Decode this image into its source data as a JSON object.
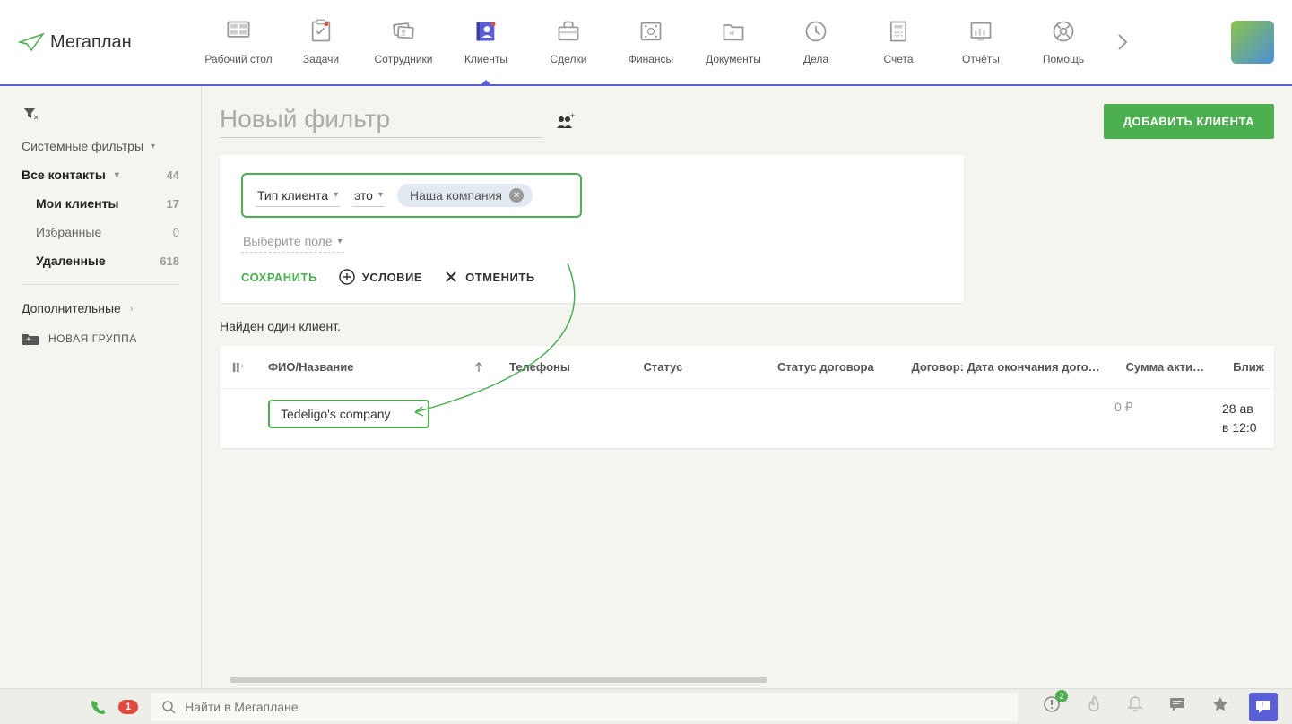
{
  "logo": "Мегаплан",
  "nav": [
    {
      "label": "Рабочий стол"
    },
    {
      "label": "Задачи"
    },
    {
      "label": "Сотрудники"
    },
    {
      "label": "Клиенты",
      "active": true
    },
    {
      "label": "Сделки"
    },
    {
      "label": "Финансы"
    },
    {
      "label": "Документы"
    },
    {
      "label": "Дела"
    },
    {
      "label": "Счета"
    },
    {
      "label": "Отчёты"
    },
    {
      "label": "Помощь"
    }
  ],
  "sidebar": {
    "system_filters": "Системные фильтры",
    "all_contacts": {
      "label": "Все контакты",
      "count": "44"
    },
    "my_clients": {
      "label": "Мои клиенты",
      "count": "17"
    },
    "favorites": {
      "label": "Избранные",
      "count": "0"
    },
    "deleted": {
      "label": "Удаленные",
      "count": "618"
    },
    "additional": "Дополнительные",
    "new_group": "НОВАЯ ГРУППА"
  },
  "page": {
    "title": "Новый фильтр",
    "add_button": "ДОБАВИТЬ КЛИЕНТА"
  },
  "filter": {
    "field": "Тип клиента",
    "op": "это",
    "value": "Наша компания",
    "select_label": "Выберите поле",
    "save": "СОХРАНИТЬ",
    "condition": "УСЛОВИЕ",
    "cancel": "ОТМЕНИТЬ"
  },
  "results_text": "Найден один клиент.",
  "table": {
    "cols": {
      "name": "ФИО/Название",
      "phone": "Телефоны",
      "status": "Статус",
      "contract_status": "Статус договора",
      "contract_date": "Договор: Дата окончания дого…",
      "amount": "Сумма акти…",
      "next": "Ближ"
    },
    "row": {
      "name": "Tedeligo's company",
      "amount": "0 ₽",
      "date1": "28 ав",
      "date2": "в 12:0"
    }
  },
  "bottom": {
    "phone_badge": "1",
    "search_placeholder": "Найти в Мегаплане",
    "alert_badge": "2"
  }
}
